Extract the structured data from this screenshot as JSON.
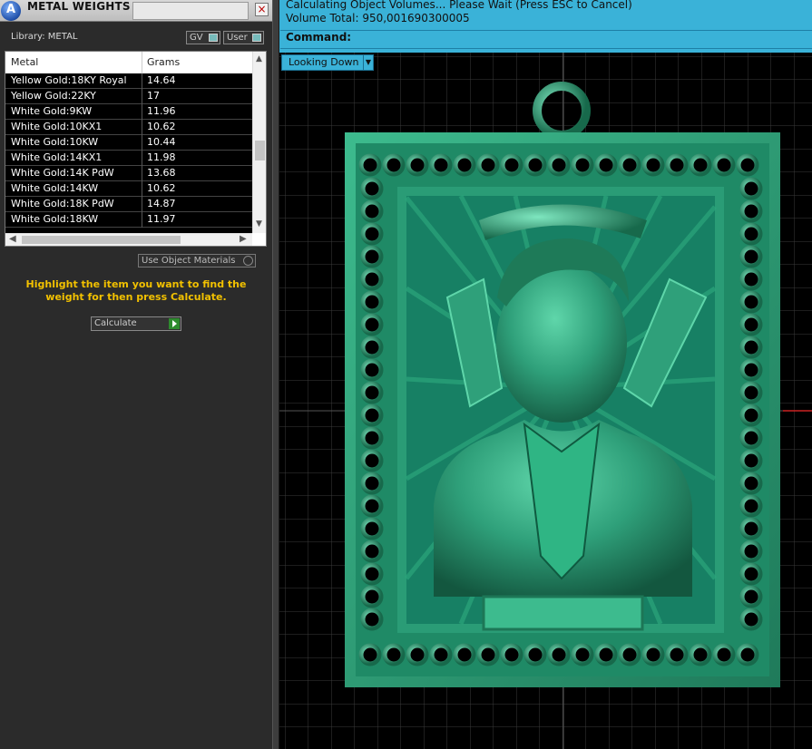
{
  "panel": {
    "title": "METAL WEIGHTS",
    "close_glyph": "×",
    "library_label": "Library: METAL",
    "toggles": [
      {
        "label": "GV"
      },
      {
        "label": "User"
      }
    ],
    "table": {
      "columns": [
        "Metal",
        "Grams"
      ],
      "rows": [
        {
          "metal": "Yellow Gold:18KY Royal",
          "grams": "14.64"
        },
        {
          "metal": "Yellow Gold:22KY",
          "grams": "17"
        },
        {
          "metal": "White Gold:9KW",
          "grams": "11.96"
        },
        {
          "metal": "White Gold:10KX1",
          "grams": "10.62"
        },
        {
          "metal": "White Gold:10KW",
          "grams": "10.44"
        },
        {
          "metal": "White Gold:14KX1",
          "grams": "11.98"
        },
        {
          "metal": "White Gold:14K PdW",
          "grams": "13.68"
        },
        {
          "metal": "White Gold:14KW",
          "grams": "10.62"
        },
        {
          "metal": "White Gold:18K PdW",
          "grams": "14.87"
        },
        {
          "metal": "White Gold:18KW",
          "grams": "11.97"
        }
      ]
    },
    "use_object_materials_label": "Use Object Materials",
    "hint": "Highlight the item you want to find the weight for then press Calculate.",
    "calculate_label": "Calculate"
  },
  "command": {
    "status_line1": "Calculating Object Volumes... Please Wait (Press ESC to Cancel)",
    "status_line2": "Volume Total: 950,001690300005",
    "prompt_label": "Command:"
  },
  "viewport": {
    "view_label": "Looking Down",
    "background_color": "#000000",
    "grid_color": "#3a3a3a",
    "model_color": "#2fa07a",
    "model_description_icon": "pendant-portrait-icon"
  }
}
